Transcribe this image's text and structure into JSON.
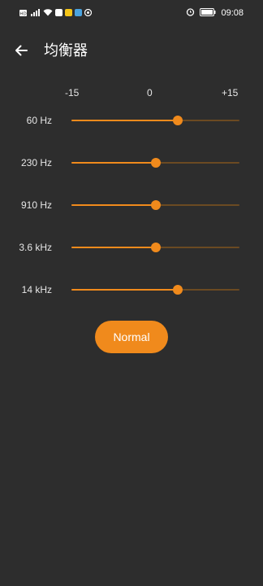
{
  "status_bar": {
    "time": "09:08",
    "left_icons": [
      "hd-icon",
      "signal-icon",
      "wifi-icon",
      "app-notification-icon",
      "app-notification-icon",
      "app-notification-icon",
      "app-notification-icon"
    ],
    "right_icons": [
      "alarm-icon",
      "battery-icon"
    ]
  },
  "header": {
    "title": "均衡器",
    "back_icon": "arrow-left-icon"
  },
  "scale": {
    "min": "-15",
    "mid": "0",
    "max": "+15",
    "min_value": -15,
    "max_value": 15
  },
  "bands": [
    {
      "label": "60 Hz",
      "gain": 4
    },
    {
      "label": "230 Hz",
      "gain": 0
    },
    {
      "label": "910 Hz",
      "gain": 0
    },
    {
      "label": "3.6 kHz",
      "gain": 0
    },
    {
      "label": "14 kHz",
      "gain": 4
    }
  ],
  "preset": {
    "label": "Normal"
  },
  "colors": {
    "background": "#2d2d2d",
    "accent": "#f08a1c",
    "track": "#6b4a22",
    "text": "#ffffff"
  }
}
